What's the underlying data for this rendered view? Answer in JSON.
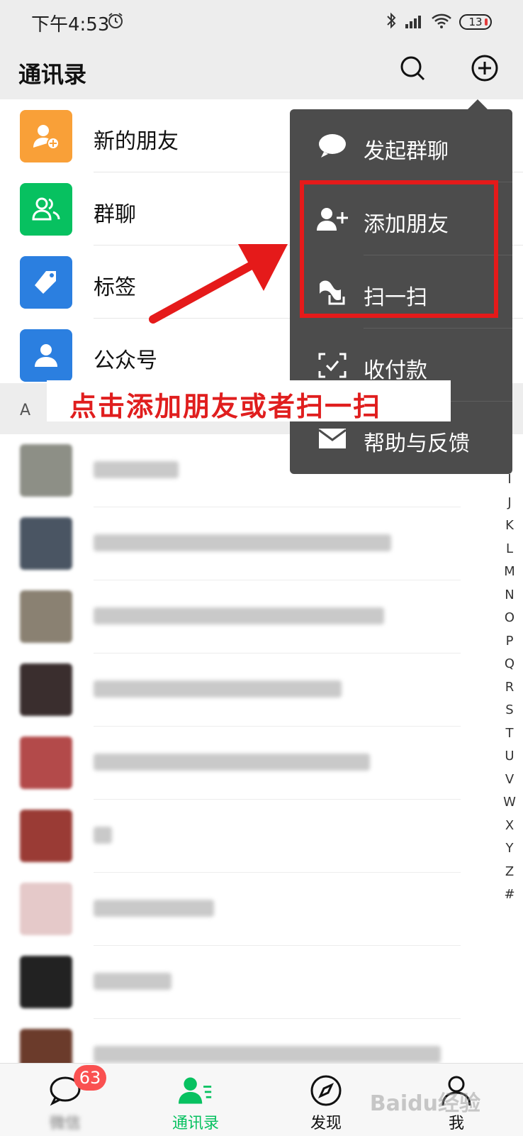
{
  "status_bar": {
    "time": "下午4:53",
    "battery": "13"
  },
  "header": {
    "title": "通讯录"
  },
  "function_rows": [
    {
      "label": "新的朋友",
      "icon": "add-friend-icon",
      "color": "#f9a038"
    },
    {
      "label": "群聊",
      "icon": "group-icon",
      "color": "#07c160"
    },
    {
      "label": "标签",
      "icon": "tag-icon",
      "color": "#2b7fe0"
    },
    {
      "label": "公众号",
      "icon": "official-account-icon",
      "color": "#2b7fe0"
    }
  ],
  "section": {
    "letter": "A"
  },
  "contacts": [
    {
      "avatar_color": "#8d8f86"
    },
    {
      "avatar_color": "#4a5563"
    },
    {
      "avatar_color": "#8a8172"
    },
    {
      "avatar_color": "#3a2e2e"
    },
    {
      "avatar_color": "#b34a4a"
    },
    {
      "avatar_color": "#9a3b35"
    },
    {
      "avatar_color": "#e5c9c9"
    },
    {
      "avatar_color": "#222222"
    },
    {
      "avatar_color": "#6b3b2b"
    }
  ],
  "index_letters": [
    "I",
    "J",
    "K",
    "L",
    "M",
    "N",
    "O",
    "P",
    "Q",
    "R",
    "S",
    "T",
    "U",
    "V",
    "W",
    "X",
    "Y",
    "Z",
    "#"
  ],
  "popup_menu": {
    "items": [
      {
        "label": "发起群聊",
        "icon": "chat-bubble-icon"
      },
      {
        "label": "添加朋友",
        "icon": "add-friend-icon"
      },
      {
        "label": "扫一扫",
        "icon": "scan-icon"
      },
      {
        "label": "收付款",
        "icon": "payment-icon"
      },
      {
        "label": "帮助与反馈",
        "icon": "mail-icon"
      }
    ]
  },
  "annotation": {
    "text": "点击添加朋友或者扫一扫",
    "color": "#e01e1e"
  },
  "tab_bar": {
    "tabs": [
      {
        "label": "微信",
        "badge": "63",
        "icon": "chat-icon"
      },
      {
        "label": "通讯录",
        "icon": "contacts-icon",
        "active": true
      },
      {
        "label": "发现",
        "icon": "compass-icon"
      },
      {
        "label": "我",
        "icon": "person-icon"
      }
    ]
  },
  "watermark": "Baidu经验",
  "colors": {
    "accent": "#07c160",
    "highlight": "#e51a1a",
    "menu_bg": "#4c4c4c",
    "badge": "#fa5151"
  }
}
